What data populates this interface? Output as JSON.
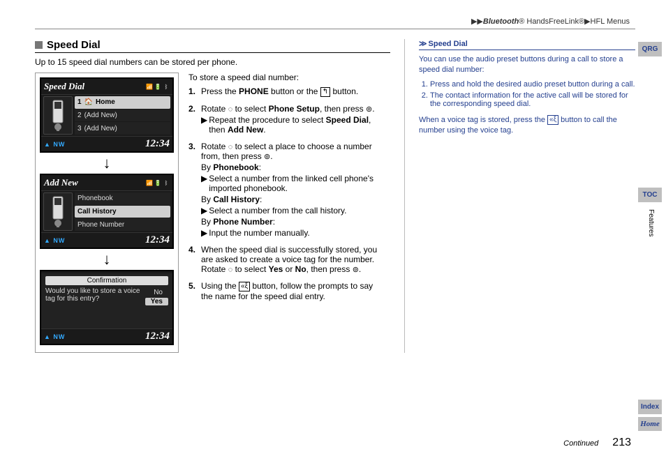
{
  "breadcrumb": {
    "b1": "Bluetooth",
    "reg": "®",
    "b2": " HandsFreeLink",
    "b3": "HFL Menus",
    "sep": "▶▶",
    "sep1": "▶"
  },
  "section": {
    "title": "Speed Dial",
    "intro": "Up to 15 speed dial numbers can be stored per phone."
  },
  "screens": {
    "s1": {
      "title": "Speed Dial",
      "rows": [
        "Home",
        "(Add New)",
        "(Add New)"
      ],
      "idx": [
        "1",
        "2",
        "3"
      ],
      "clock": "12:34",
      "nw": "NW"
    },
    "s2": {
      "title": "Add New",
      "rows": [
        "Phonebook",
        "Call History",
        "Phone Number"
      ],
      "clock": "12:34",
      "nw": "NW"
    },
    "s3": {
      "title": "Confirmation",
      "text": "Would you like to store a voice tag for this entry?",
      "no": "No",
      "yes": "Yes",
      "clock": "12:34",
      "nw": "NW"
    },
    "arrow": "↓"
  },
  "steps": {
    "lead": "To store a speed dial number:",
    "s1a": "Press the ",
    "s1b": "PHONE",
    "s1c": " button or the ",
    "s1d": " button.",
    "s2a": "Rotate ",
    "s2b": " to select ",
    "s2c": "Phone Setup",
    "s2d": ", then press ",
    "s2e": ".",
    "s2sub_a": "Repeat the procedure to select ",
    "s2sub_b": "Speed Dial",
    "s2sub_c": ", then ",
    "s2sub_d": "Add New",
    "s2sub_e": ".",
    "s3a": "Rotate ",
    "s3b": " to select a place to choose a number from, then press ",
    "s3c": ".",
    "s3_pb": "By ",
    "s3_pb_b": "Phonebook",
    "s3_pb_c": ":",
    "s3_pb_sub": "Select a number from the linked cell phone's imported phonebook.",
    "s3_ch": "By ",
    "s3_ch_b": "Call History",
    "s3_ch_c": ":",
    "s3_ch_sub": "Select a number from the call history.",
    "s3_pn": "By ",
    "s3_pn_b": "Phone Number",
    "s3_pn_c": ":",
    "s3_pn_sub": "Input the number manually.",
    "s4a": "When the speed dial is successfully stored, you are asked to create a voice tag for the number. Rotate ",
    "s4b": " to select ",
    "s4c": "Yes",
    "s4d": " or ",
    "s4e": "No",
    "s4f": ", then press ",
    "s4g": ".",
    "s5a": "Using the ",
    "s5b": " button, follow the prompts to say the name for the speed dial entry.",
    "n1": "1.",
    "n2": "2.",
    "n3": "3.",
    "n4": "4.",
    "n5": "5.",
    "tri": "▶"
  },
  "sidebar": {
    "title": "Speed Dial",
    "chev": "≫",
    "p1": "You can use the audio preset buttons during a call to store a speed dial number:",
    "li1": "Press and hold the desired audio preset button during a call.",
    "li2": "The contact information for the active call will be stored for the corresponding speed dial.",
    "p2a": "When a voice tag is stored, press the ",
    "p2b": " button to call the number using the voice tag."
  },
  "nav": {
    "qrg": "QRG",
    "toc": "TOC",
    "features": "Features",
    "index": "Index",
    "home": "Home"
  },
  "footer": {
    "continued": "Continued",
    "page": "213"
  },
  "icons": {
    "pickup": "↰",
    "talk": "⎇",
    "rotate": "◎",
    "press": "⊚",
    "home": "🏠",
    "signal": "▮",
    "bt": "B",
    "batt": "▯"
  }
}
